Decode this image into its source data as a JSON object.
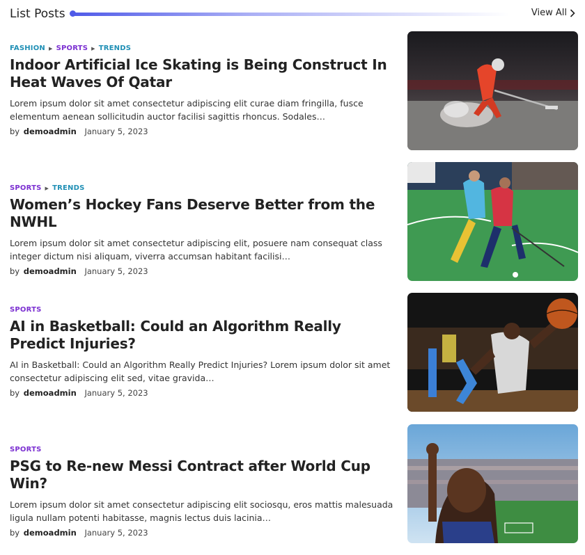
{
  "header": {
    "title": "List Posts",
    "view_all": "View All"
  },
  "posts": [
    {
      "categories": [
        "FASHION",
        "SPORTS",
        "TRENDS"
      ],
      "title": "Indoor Artificial Ice Skating is Being Construct In Heat Waves Of Qatar",
      "excerpt": "Lorem ipsum dolor sit amet consectetur adipiscing elit curae diam fringilla, fusce elementum aenean sollicitudin auctor facilisi sagittis rhoncus. Sodales…",
      "by": "by",
      "author": "demoadmin",
      "date": "January 5, 2023",
      "image": "ice-hockey-player-photo"
    },
    {
      "categories": [
        "SPORTS",
        "TRENDS"
      ],
      "title": "Women’s Hockey Fans Deserve Better from the NWHL",
      "excerpt": "Lorem ipsum dolor sit amet consectetur adipiscing elit, posuere nam consequat class integer dictum nisi aliquam, viverra accumsan habitant facilisi…",
      "by": "by",
      "author": "demoadmin",
      "date": "January 5, 2023",
      "image": "field-hockey-players-photo"
    },
    {
      "categories": [
        "SPORTS"
      ],
      "title": "AI in Basketball: Could an Algorithm Really Predict Injuries?",
      "excerpt": "AI in Basketball: Could an Algorithm Really Predict Injuries? Lorem ipsum dolor sit amet consectetur adipiscing elit sed, vitae gravida…",
      "by": "by",
      "author": "demoadmin",
      "date": "January 5, 2023",
      "image": "basketball-player-photo"
    },
    {
      "categories": [
        "SPORTS"
      ],
      "title": "PSG to Re-new Messi Contract after World Cup Win?",
      "excerpt": "Lorem ipsum dolor sit amet consectetur adipiscing elit sociosqu, eros mattis malesuada ligula nullam potenti habitasse, magnis lectus duis lacinia…",
      "by": "by",
      "author": "demoadmin",
      "date": "January 5, 2023",
      "image": "stadium-fan-photo"
    }
  ],
  "colors": {
    "accent": "#4f5ae8",
    "category_blue": "#1f8fb5",
    "category_purple": "#7b2fd1"
  }
}
